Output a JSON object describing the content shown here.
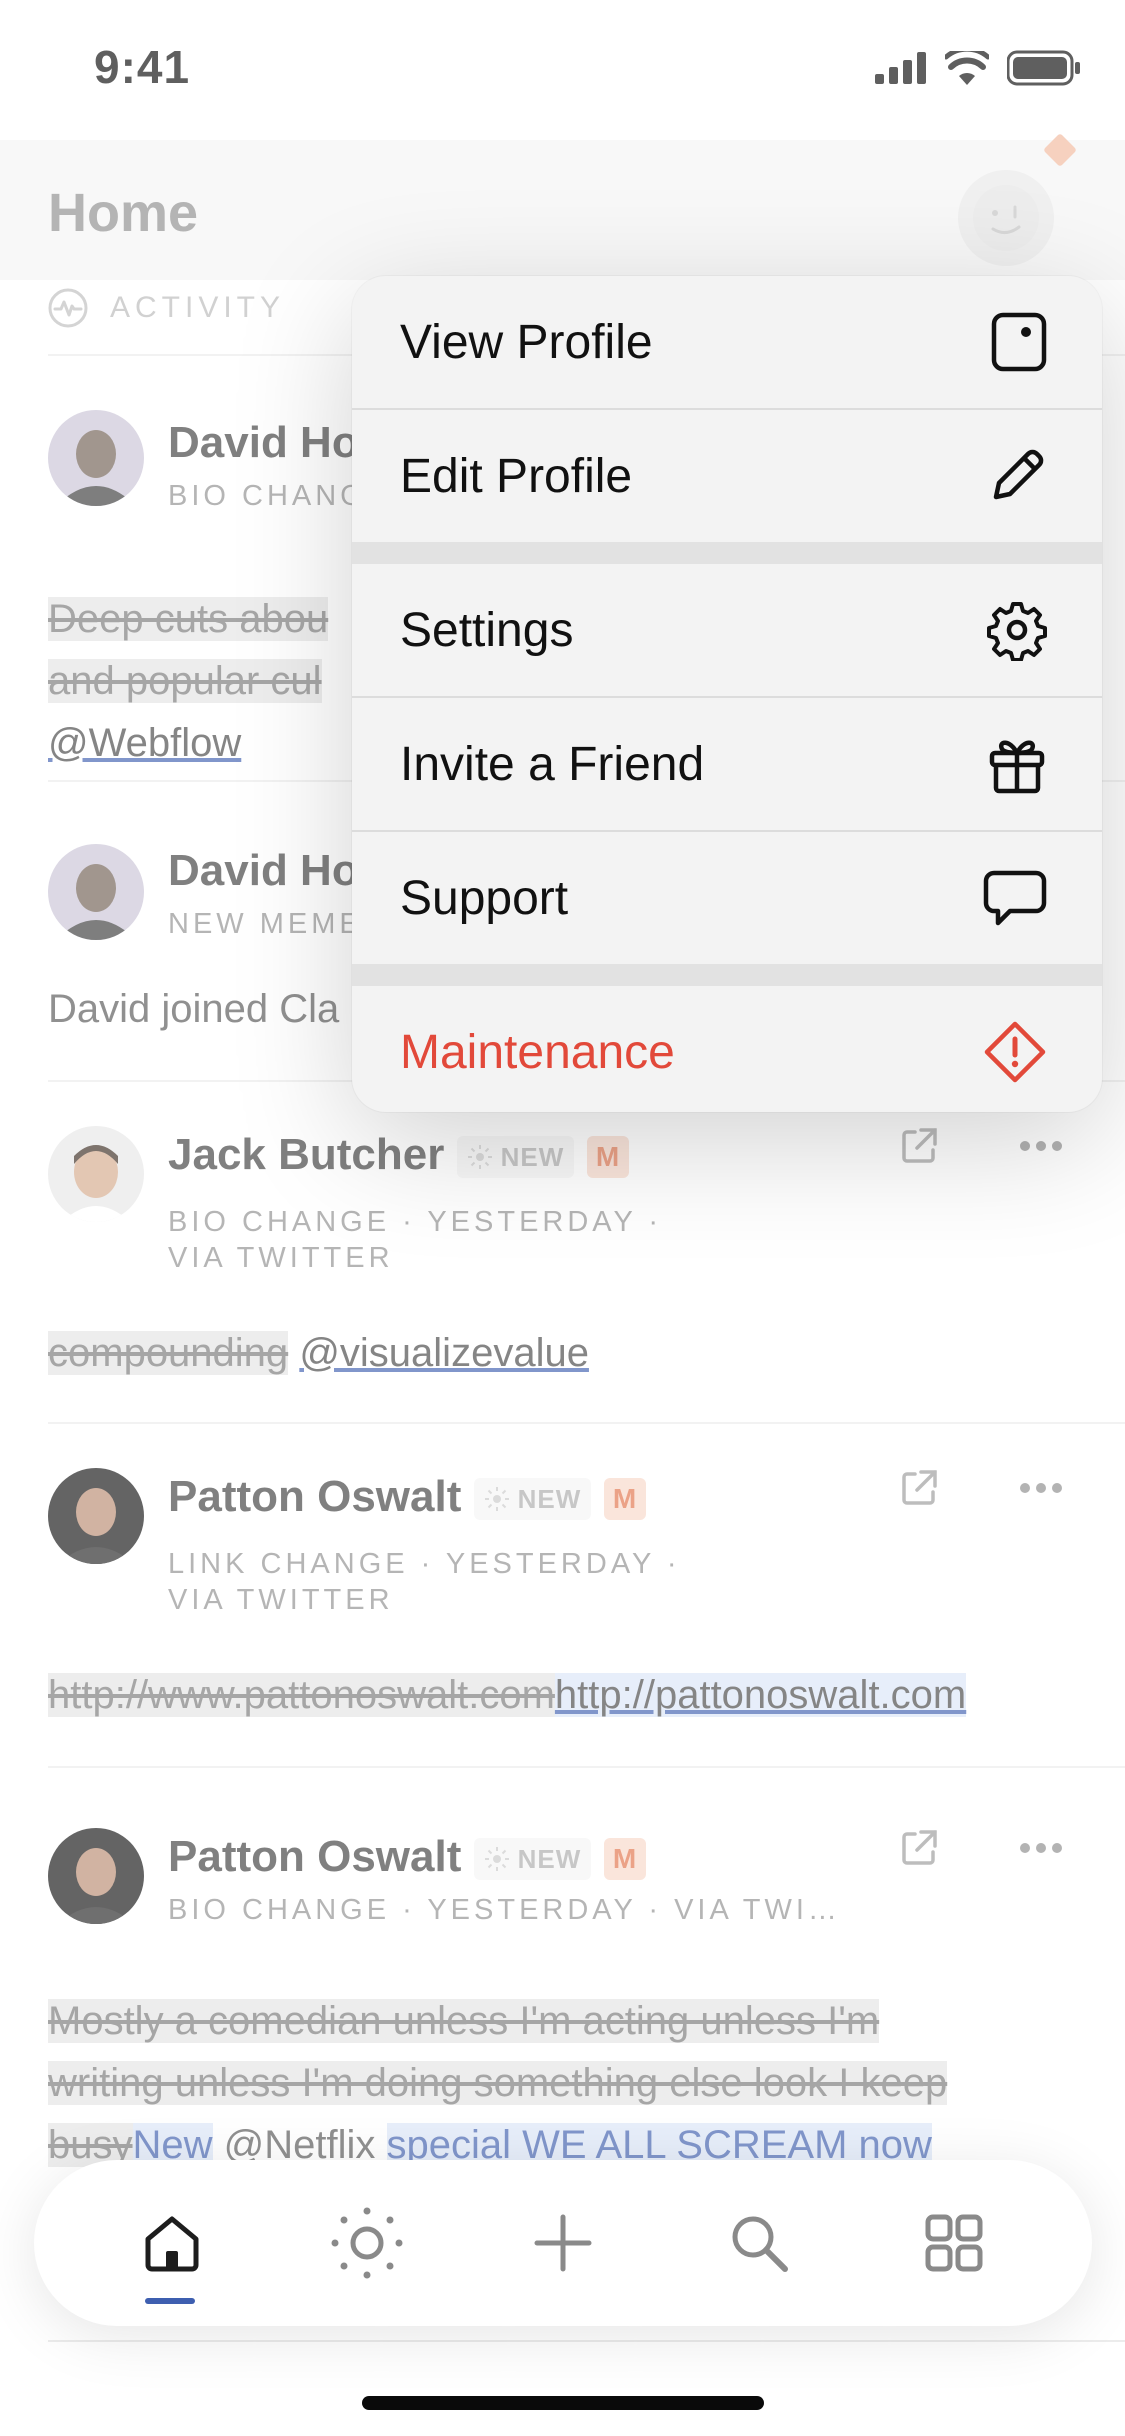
{
  "status_bar": {
    "time": "9:41"
  },
  "header": {
    "title": "Home",
    "section_label": "ACTIVITY"
  },
  "feed": [
    {
      "name": "David Ho",
      "meta": "BIO CHANG",
      "body_removed_1": "Deep cuts abou",
      "body_removed_2": "and popular cul",
      "body_link": "@Webflow"
    },
    {
      "name": "David Ho",
      "meta": "NEW MEME",
      "body": "David joined Cla"
    },
    {
      "name": "Jack Butcher",
      "new_label": "NEW",
      "badge": "M",
      "meta_line1": "BIO CHANGE · YESTERDAY ·",
      "meta_line2": "VIA TWITTER",
      "body_removed": "compounding",
      "body_link": "@visualizevalue"
    },
    {
      "name": "Patton Oswalt",
      "new_label": "NEW",
      "badge": "M",
      "meta_line1": "LINK CHANGE · YESTERDAY ·",
      "meta_line2": "VIA TWITTER",
      "body_removed": "http://www.pattonoswalt.com",
      "body_added": "http://pattonoswalt.com"
    },
    {
      "name": "Patton Oswalt",
      "new_label": "NEW",
      "badge": "M",
      "meta_line1": "BIO CHANGE · YESTERDAY · VIA TWI…",
      "body_removed_1": "Mostly a comedian unless I'm acting unless I'm",
      "body_removed_2": "writing unless I'm doing something else look I keep",
      "body_removed_3": "busy",
      "body_added_1": "New",
      "body_plain": " @Netflix ",
      "body_added_2": "special WE ALL SCREAM now"
    }
  ],
  "menu": {
    "items": [
      {
        "label": "View Profile",
        "icon": "profile-card-icon"
      },
      {
        "label": "Edit Profile",
        "icon": "pencil-icon"
      },
      {
        "label": "Settings",
        "icon": "gear-icon"
      },
      {
        "label": "Invite a Friend",
        "icon": "gift-icon"
      },
      {
        "label": "Support",
        "icon": "chat-bubble-icon"
      },
      {
        "label": "Maintenance",
        "icon": "warning-diamond-icon"
      }
    ]
  },
  "tabbar": {
    "tabs": [
      {
        "name": "home-icon",
        "active": true
      },
      {
        "name": "sun-icon"
      },
      {
        "name": "plus-icon"
      },
      {
        "name": "search-icon"
      },
      {
        "name": "grid-icon"
      }
    ]
  },
  "colors": {
    "accent": "#3e5fb0",
    "danger": "#e2493a",
    "badge_bg": "#f7d7c8",
    "badge_fg": "#e07048"
  }
}
